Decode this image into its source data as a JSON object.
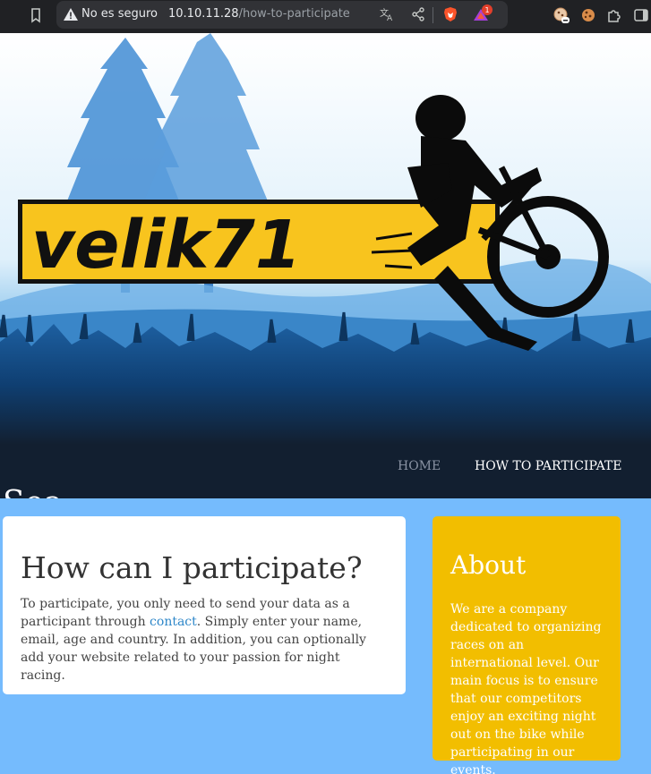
{
  "browser": {
    "security_label": "No es seguro",
    "url_host": "10.10.11.28",
    "url_path": "/how-to-participate",
    "icons": [
      "bookmark-icon",
      "warning-icon",
      "translate-icon",
      "share-icon",
      "brave-shield-icon",
      "brave-rewards-icon",
      "extension-cookie-icon",
      "cookie-icon",
      "puzzle-icon",
      "sidebar-icon"
    ],
    "notification_count": "1"
  },
  "header": {
    "logo_text": "velik71",
    "site_title": "Sea",
    "nav": {
      "home": "HOME",
      "how": "HOW TO PARTICIPATE"
    }
  },
  "main": {
    "title": "How can I participate?",
    "body_before": "To participate, you only need to send your data as a participant through ",
    "link": "contact",
    "body_after": ". Simply enter your name, email, age and country. In addition, you can optionally add your website related to your passion for night racing."
  },
  "about": {
    "title": "About",
    "body": "We are a company dedicated to organizing races on an international level. Our main focus is to ensure that our competitors enjoy an exciting night out on the bike while participating in our events."
  },
  "colors": {
    "page_bg": "#75bbfd",
    "header_bg": "#121f30",
    "about_bg": "#f2be00",
    "link": "#2e87c9",
    "logo_yellow": "#f8c41e"
  }
}
